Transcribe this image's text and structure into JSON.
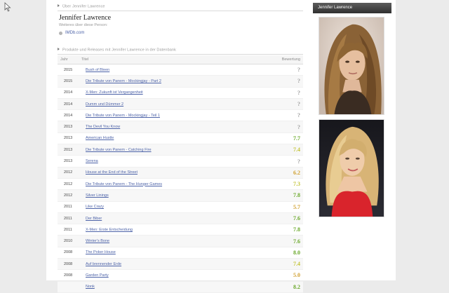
{
  "breadcrumb": "Über Jennifer Lawrence",
  "person": {
    "name": "Jennifer Lawrence",
    "subtitle": "Weiteres über diese Person:",
    "imdb_label": "IMDb.com"
  },
  "films_section": {
    "header": "Produkte und Releases mit Jennifer Lawrence in der Datenbank",
    "columns": {
      "year": "Jahr",
      "title": "Titel",
      "rating": "Bewertung"
    },
    "rows": [
      {
        "year": "2015",
        "title": "Bush of Bleen",
        "rating": "?"
      },
      {
        "year": "2015",
        "title": "Die Tribute von Panem - Mockingjay - Part 2",
        "rating": "?"
      },
      {
        "year": "2014",
        "title": "X-Men: Zukunft ist Vergangenheit",
        "rating": "?"
      },
      {
        "year": "2014",
        "title": "Dumm und Dümmer 2",
        "rating": "?"
      },
      {
        "year": "2014",
        "title": "Die Tribute von Panem - Mockingjay - Teil 1",
        "rating": "?"
      },
      {
        "year": "2013",
        "title": "The Devil You Know",
        "rating": "?"
      },
      {
        "year": "2013",
        "title": "American Hustle",
        "rating": "7.7"
      },
      {
        "year": "2013",
        "title": "Die Tribute von Panem - Catching Fire",
        "rating": "7.4"
      },
      {
        "year": "2013",
        "title": "Serena",
        "rating": "?"
      },
      {
        "year": "2012",
        "title": "House at the End of the Street",
        "rating": "6.2"
      },
      {
        "year": "2012",
        "title": "Die Tribute von Panem - The Hunger Games",
        "rating": "7.3"
      },
      {
        "year": "2012",
        "title": "Silver Linings",
        "rating": "7.8"
      },
      {
        "year": "2011",
        "title": "Like Crazy",
        "rating": "5.7"
      },
      {
        "year": "2011",
        "title": "Der Biber",
        "rating": "7.6"
      },
      {
        "year": "2011",
        "title": "X-Men: Erste Entscheidung",
        "rating": "7.8"
      },
      {
        "year": "2010",
        "title": "Winter's Bone",
        "rating": "7.6"
      },
      {
        "year": "2008",
        "title": "The Poker House",
        "rating": "8.0"
      },
      {
        "year": "2008",
        "title": "Auf brennender Erde",
        "rating": "7.4"
      },
      {
        "year": "2008",
        "title": "Garden Party",
        "rating": "5.0"
      },
      {
        "year": "",
        "title": "Nonk",
        "rating": "8.2"
      }
    ]
  },
  "sidebar": {
    "panel_title": "Jennifer Lawrence"
  },
  "rating_colors": {
    "unknown": "#9a9a9a",
    "good": "#6aa82a",
    "mid": "#c4c43a",
    "low": "#d0a030"
  }
}
